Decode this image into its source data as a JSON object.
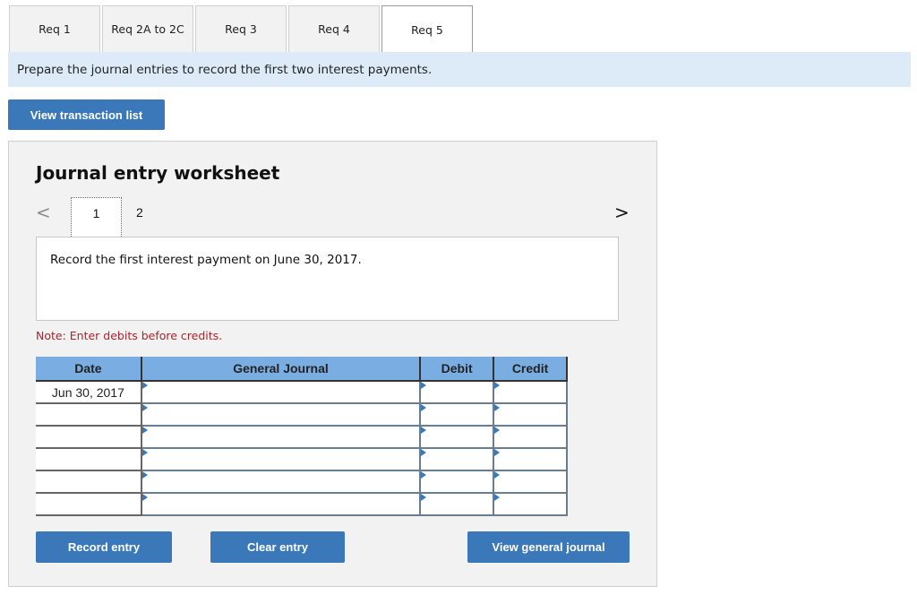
{
  "tabs": [
    {
      "label": "Req 1",
      "active": false
    },
    {
      "label": "Req 2A to 2C",
      "active": false
    },
    {
      "label": "Req 3",
      "active": false
    },
    {
      "label": "Req 4",
      "active": false
    },
    {
      "label": "Req 5",
      "active": true
    }
  ],
  "instruction": "Prepare the journal entries to record the first two interest payments.",
  "view_transaction_list_label": "View transaction list",
  "worksheet": {
    "title": "Journal entry worksheet",
    "prev_icon": "chevron-left-icon",
    "next_icon": "chevron-right-icon",
    "prev_glyph": "<",
    "next_glyph": ">",
    "pages": [
      "1",
      "2"
    ],
    "current_page": "1",
    "description": "Record the first interest payment on June 30, 2017.",
    "note": "Note: Enter debits before credits.",
    "table": {
      "headers": {
        "date": "Date",
        "general_journal": "General Journal",
        "debit": "Debit",
        "credit": "Credit"
      },
      "rows": [
        {
          "date": "Jun 30, 2017",
          "account": "",
          "debit": "",
          "credit": ""
        },
        {
          "date": "",
          "account": "",
          "debit": "",
          "credit": ""
        },
        {
          "date": "",
          "account": "",
          "debit": "",
          "credit": ""
        },
        {
          "date": "",
          "account": "",
          "debit": "",
          "credit": ""
        },
        {
          "date": "",
          "account": "",
          "debit": "",
          "credit": ""
        },
        {
          "date": "",
          "account": "",
          "debit": "",
          "credit": ""
        }
      ]
    },
    "buttons": {
      "record_entry": "Record entry",
      "clear_entry": "Clear entry",
      "view_general_journal": "View general journal"
    }
  },
  "colors": {
    "accent_button": "#3b78b9",
    "banner_bg": "#dcebf7",
    "table_header_bg": "#7aaee2",
    "note_text": "#b3212a",
    "panel_bg": "#f2f2f2"
  }
}
